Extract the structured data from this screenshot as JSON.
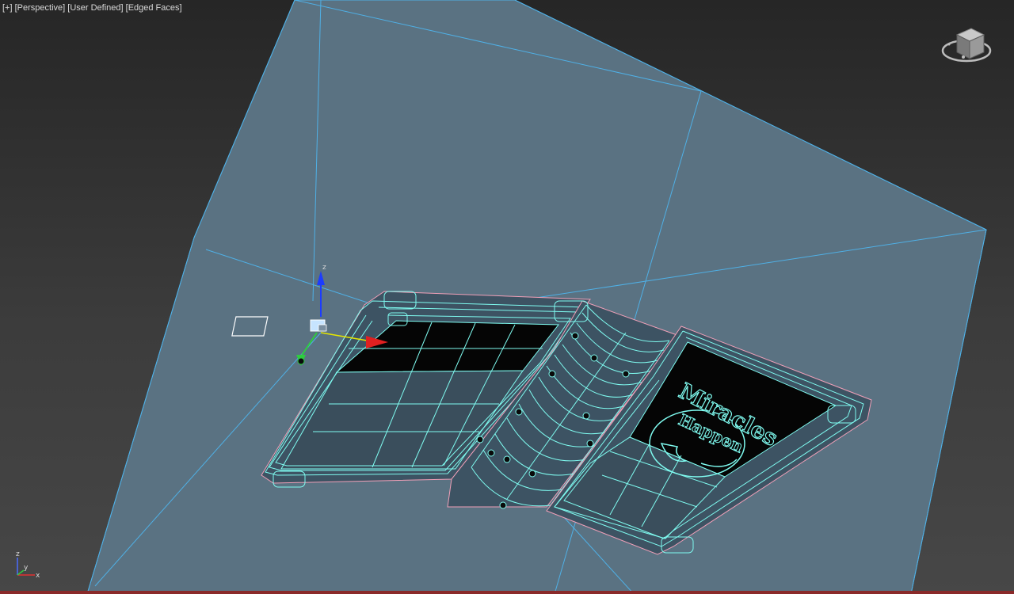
{
  "viewport": {
    "labels": [
      "[+]",
      "[Perspective]",
      "[User Defined]",
      "[Edged Faces]"
    ]
  },
  "scene": {
    "book_cover_text_line1": "Miracles",
    "book_cover_text_line2": "Happen",
    "colors": {
      "ground_plane": "#5a7282",
      "wire_selected": "#7ffbf0",
      "wire_outline": "#f0a0b8",
      "grid_lines": "#4fb0e6",
      "gizmo_z": "#1c3cff",
      "gizmo_x": "#e02020",
      "gizmo_y": "#2ecc40"
    }
  },
  "gizmo": {
    "z_label": "z"
  },
  "axis_tripod": {
    "z_label": "z",
    "x_label": "x",
    "y_label": "y"
  },
  "icons": {
    "viewcube": "viewcube-icon",
    "axis_tripod": "axis-tripod-icon",
    "transform_gizmo": "transform-gizmo-icon"
  }
}
